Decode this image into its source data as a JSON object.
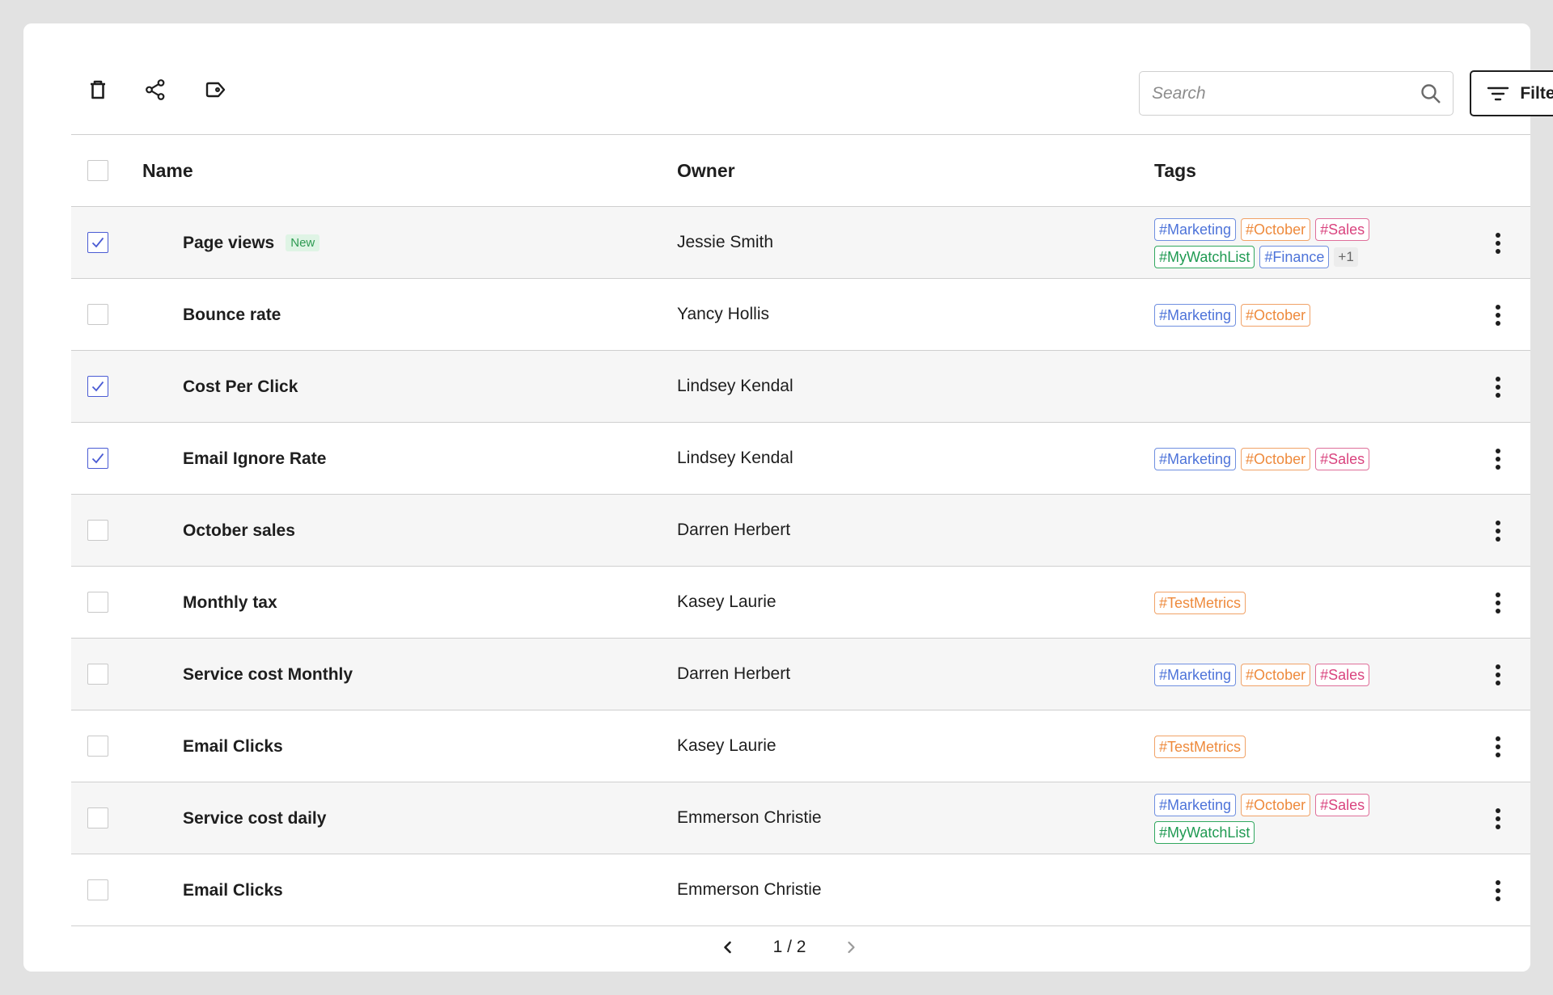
{
  "search": {
    "placeholder": "Search"
  },
  "filter": {
    "label": "Filter"
  },
  "columns": {
    "name": "Name",
    "owner": "Owner",
    "tags": "Tags"
  },
  "rows": [
    {
      "name": "Page views",
      "badge": "New",
      "owner": "Jessie Smith",
      "checked": true,
      "tags": [
        [
          "#Marketing",
          "blue"
        ],
        [
          "#October",
          "orange"
        ],
        [
          "#Sales",
          "pink"
        ],
        [
          "#MyWatchList",
          "green"
        ],
        [
          "#Finance",
          "blue"
        ]
      ],
      "more": "+1"
    },
    {
      "name": "Bounce rate",
      "owner": "Yancy Hollis",
      "checked": false,
      "tags": [
        [
          "#Marketing",
          "blue"
        ],
        [
          "#October",
          "orange"
        ]
      ]
    },
    {
      "name": "Cost Per Click",
      "owner": "Lindsey Kendal",
      "checked": true,
      "tags": []
    },
    {
      "name": "Email Ignore Rate",
      "owner": "Lindsey Kendal",
      "checked": true,
      "tags": [
        [
          "#Marketing",
          "blue"
        ],
        [
          "#October",
          "orange"
        ],
        [
          "#Sales",
          "pink"
        ]
      ]
    },
    {
      "name": "October sales",
      "owner": "Darren Herbert",
      "checked": false,
      "tags": []
    },
    {
      "name": "Monthly tax",
      "owner": "Kasey Laurie",
      "checked": false,
      "tags": [
        [
          "#TestMetrics",
          "orange"
        ]
      ]
    },
    {
      "name": "Service cost Monthly",
      "owner": "Darren Herbert",
      "checked": false,
      "tags": [
        [
          "#Marketing",
          "blue"
        ],
        [
          "#October",
          "orange"
        ],
        [
          "#Sales",
          "pink"
        ]
      ]
    },
    {
      "name": "Email Clicks",
      "owner": "Kasey Laurie",
      "checked": false,
      "tags": [
        [
          "#TestMetrics",
          "orange"
        ]
      ]
    },
    {
      "name": "Service cost daily",
      "owner": "Emmerson Christie",
      "checked": false,
      "tags": [
        [
          "#Marketing",
          "blue"
        ],
        [
          "#October",
          "orange"
        ],
        [
          "#Sales",
          "pink"
        ],
        [
          "#MyWatchList",
          "green"
        ]
      ]
    },
    {
      "name": "Email Clicks",
      "owner": "Emmerson Christie",
      "checked": false,
      "tags": []
    }
  ],
  "pagination": {
    "label": "1 / 2"
  },
  "icons": {
    "toolbar": [
      "trash-icon",
      "share-icon",
      "tag-icon"
    ],
    "search": "search-icon",
    "filter": "filter-icon",
    "row_menu": "more-vertical-icon",
    "prev": "chevron-left-icon",
    "next": "chevron-right-icon"
  },
  "colors": {
    "check_accent": "#4a5bd4",
    "tag_blue": "#4d73d9",
    "tag_orange": "#ee8a3c",
    "tag_pink": "#d9437e",
    "tag_green": "#1f9a52",
    "badge_new": "#2e9a52"
  }
}
